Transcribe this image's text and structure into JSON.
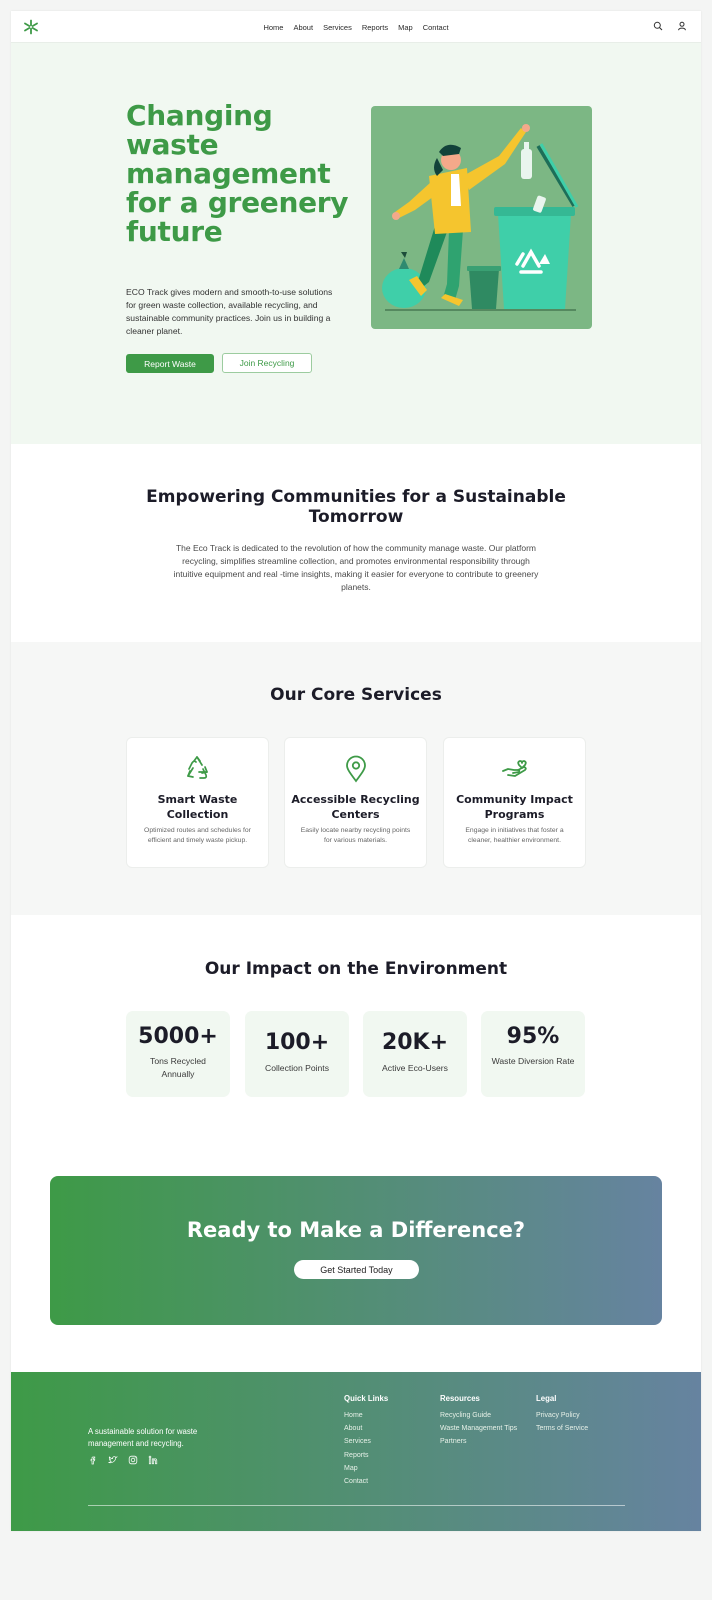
{
  "nav": {
    "links": [
      "Home",
      "About",
      "Services",
      "Reports",
      "Map",
      "Contact"
    ]
  },
  "hero": {
    "title": "Changing waste management for a greenery future",
    "description": "ECO Track gives modern and smooth-to-use solutions for green waste collection, available recycling, and sustainable community practices. Join us in building a cleaner planet.",
    "primary_button": "Report Waste",
    "secondary_button": "Join Recycling"
  },
  "mission": {
    "title": "Empowering Communities for a Sustainable Tomorrow",
    "text": "The Eco Track is dedicated to the revolution of how the community manage waste. Our platform recycling, simplifies streamline collection, and promotes environmental responsibility through intuitive equipment and real -time insights, making it easier for everyone to contribute to greenery planets."
  },
  "services": {
    "title": "Our Core Services",
    "cards": [
      {
        "icon": "recycle-icon",
        "title": "Smart Waste Collection",
        "text": "Optimized routes and schedules for efficient and timely waste pickup."
      },
      {
        "icon": "map-pin-icon",
        "title": "Accessible Recycling Centers",
        "text": "Easily locate nearby recycling points for various materials."
      },
      {
        "icon": "hand-heart-icon",
        "title": "Community Impact Programs",
        "text": "Engage in initiatives that foster a cleaner, healthier environment."
      }
    ]
  },
  "impact": {
    "title": "Our Impact on the Environment",
    "stats": [
      {
        "value": "5000+",
        "label": "Tons Recycled Annually"
      },
      {
        "value": "100+",
        "label": "Collection Points"
      },
      {
        "value": "20K+",
        "label": "Active Eco-Users"
      },
      {
        "value": "95%",
        "label": "Waste Diversion Rate"
      }
    ]
  },
  "cta": {
    "title": "Ready to Make a Difference?",
    "button": "Get Started Today"
  },
  "footer": {
    "tagline": "A sustainable solution for waste management and recycling.",
    "social": [
      "facebook-icon",
      "twitter-icon",
      "instagram-icon",
      "linkedin-icon"
    ],
    "columns": [
      {
        "title": "Quick Links",
        "links": [
          "Home",
          "About",
          "Services",
          "Reports",
          "Map",
          "Contact"
        ]
      },
      {
        "title": "Resources",
        "links": [
          "Recycling Guide",
          "Waste Management Tips",
          "Partners"
        ]
      },
      {
        "title": "Legal",
        "links": [
          "Privacy Policy",
          "Terms of Service"
        ]
      }
    ]
  },
  "colors": {
    "brand_green": "#3e9a47",
    "gradient_end": "#6683a0",
    "hero_bg": "#f1f8f1",
    "bin_teal": "#3fcfa9"
  }
}
